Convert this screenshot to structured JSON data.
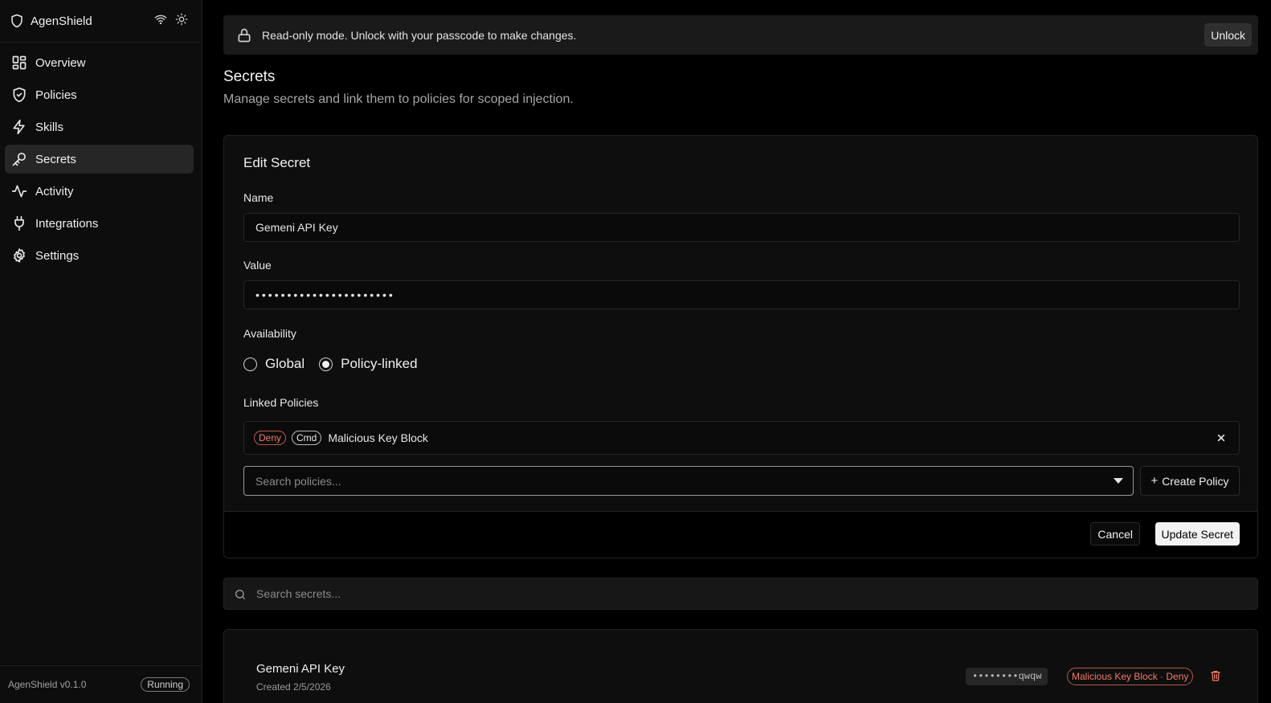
{
  "app": {
    "name": "AgenShield",
    "version": "AgenShield v0.1.0",
    "status": "Running"
  },
  "header_icons": [
    "wifi-icon",
    "sun-icon"
  ],
  "sidebar": {
    "items": [
      {
        "label": "Overview",
        "icon": "grid-icon"
      },
      {
        "label": "Policies",
        "icon": "shield-check-icon"
      },
      {
        "label": "Skills",
        "icon": "lightning-icon"
      },
      {
        "label": "Secrets",
        "icon": "key-icon",
        "active": true
      },
      {
        "label": "Activity",
        "icon": "activity-icon"
      },
      {
        "label": "Integrations",
        "icon": "plug-icon"
      },
      {
        "label": "Settings",
        "icon": "gear-icon"
      }
    ]
  },
  "banner": {
    "message": "Read-only mode. Unlock with your passcode to make changes.",
    "button": "Unlock"
  },
  "page": {
    "title": "Secrets",
    "subtitle": "Manage secrets and link them to policies for scoped injection."
  },
  "form": {
    "title": "Edit Secret",
    "name_label": "Name",
    "name_value": "Gemeni API Key",
    "value_label": "Value",
    "value_masked": "••••••••••••••••••••••",
    "availability_label": "Availability",
    "availability_options": [
      {
        "label": "Global",
        "selected": false
      },
      {
        "label": "Policy-linked",
        "selected": true
      }
    ],
    "linked_label": "Linked Policies",
    "linked_policy": {
      "action": "Deny",
      "type": "Cmd",
      "name": "Malicious Key Block"
    },
    "search_placeholder": "Search policies...",
    "create_policy": "Create Policy",
    "cancel": "Cancel",
    "submit": "Update Secret"
  },
  "secrets_search": {
    "placeholder": "Search secrets..."
  },
  "secrets": [
    {
      "name": "Gemeni API Key",
      "created": "Created 2/5/2026",
      "masked": "••••••••qwqw",
      "policy": "Malicious Key Block · Deny"
    }
  ],
  "colors": {
    "background": "#000000",
    "sidebar": "#0d0d0d",
    "active_nav": "#262626",
    "deny": "#f07a6a"
  }
}
